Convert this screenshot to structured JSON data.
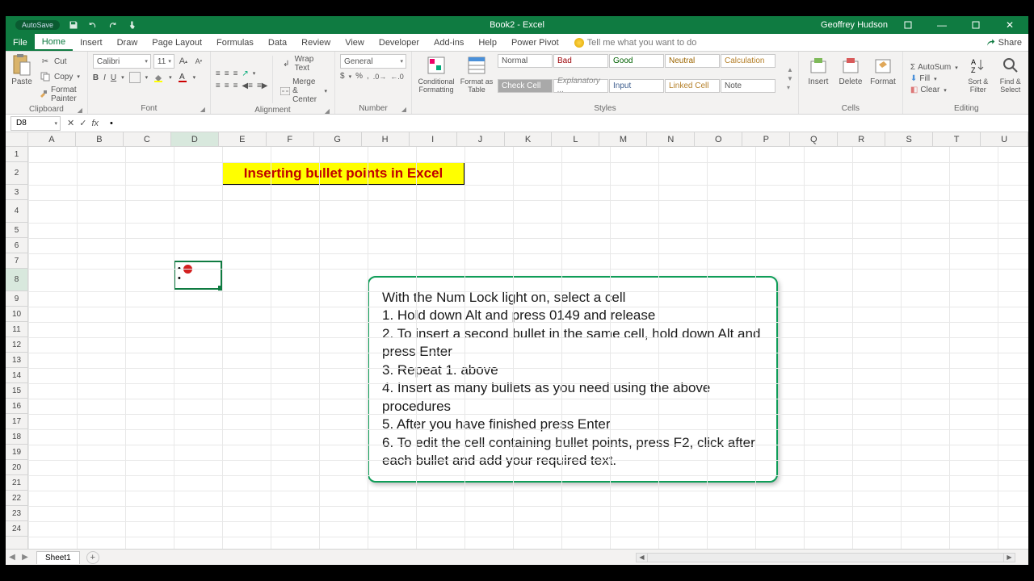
{
  "window": {
    "title": "Book2 - Excel",
    "user": "Geoffrey Hudson",
    "autosave": "AutoSave"
  },
  "tabs": {
    "file": "File",
    "items": [
      "Home",
      "Insert",
      "Draw",
      "Page Layout",
      "Formulas",
      "Data",
      "Review",
      "View",
      "Developer",
      "Add-ins",
      "Help",
      "Power Pivot"
    ],
    "active": "Home",
    "tellme": "Tell me what you want to do",
    "share": "Share"
  },
  "ribbon": {
    "clipboard": {
      "label": "Clipboard",
      "paste": "Paste",
      "cut": "Cut",
      "copy": "Copy",
      "fmt": "Format Painter"
    },
    "font": {
      "label": "Font",
      "name": "Calibri",
      "size": "11"
    },
    "alignment": {
      "label": "Alignment",
      "wrap": "Wrap Text",
      "merge": "Merge & Center"
    },
    "number": {
      "label": "Number",
      "format": "General"
    },
    "styles": {
      "label": "Styles",
      "cond": "Conditional Formatting",
      "fmtTable": "Format as Table",
      "cells": [
        "Normal",
        "Bad",
        "Good",
        "Neutral",
        "Calculation",
        "Check Cell",
        "Explanatory ...",
        "Input",
        "Linked Cell",
        "Note"
      ]
    },
    "cells": {
      "label": "Cells",
      "insert": "Insert",
      "delete": "Delete",
      "format": "Format"
    },
    "editing": {
      "label": "Editing",
      "autosum": "AutoSum",
      "fill": "Fill",
      "clear": "Clear",
      "sort": "Sort & Filter",
      "find": "Find & Select"
    }
  },
  "formula": {
    "namebox": "D8",
    "value": "•"
  },
  "columns": [
    "A",
    "B",
    "C",
    "D",
    "E",
    "F",
    "G",
    "H",
    "I",
    "J",
    "K",
    "L",
    "M",
    "N",
    "O",
    "P",
    "Q",
    "R",
    "S",
    "T",
    "U"
  ],
  "rows_count": 24,
  "active_col": "D",
  "active_row": 8,
  "cells": {
    "title": "Inserting bullet points in Excel",
    "d8_lines": [
      "•",
      "•"
    ]
  },
  "instructions": [
    "With the Num Lock light on, select a cell",
    "1. Hold down Alt and press 0149  and release",
    "2. To insert a second bullet in the same cell, hold down Alt and press Enter",
    "3. Repeat 1. above",
    "4. Insert as many bullets as you need using the above procedures",
    "5. After you have finished press Enter",
    "6. To edit the cell containing bullet points, press F2, click after each bullet and add your required text."
  ],
  "sheet": {
    "tabs": [
      "Sheet1"
    ]
  }
}
